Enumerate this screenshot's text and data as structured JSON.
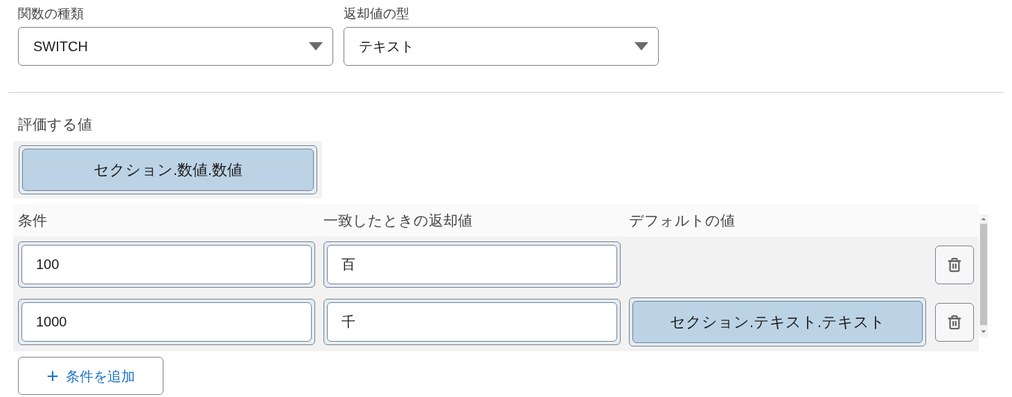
{
  "selects": [
    {
      "label": "関数の種類",
      "value": "SWITCH"
    },
    {
      "label": "返却値の型",
      "value": "テキスト"
    }
  ],
  "evaluate": {
    "label": "評価する値",
    "value": "セクション.数値.数値"
  },
  "table": {
    "columns": [
      "条件",
      "一致したときの返却値",
      "デフォルトの値"
    ],
    "rows": [
      {
        "condition": "100",
        "result": "百"
      },
      {
        "condition": "1000",
        "result": "千",
        "default": "セクション.テキスト.テキスト"
      }
    ]
  },
  "add_button": {
    "icon": "+",
    "label": "条件を追加"
  }
}
